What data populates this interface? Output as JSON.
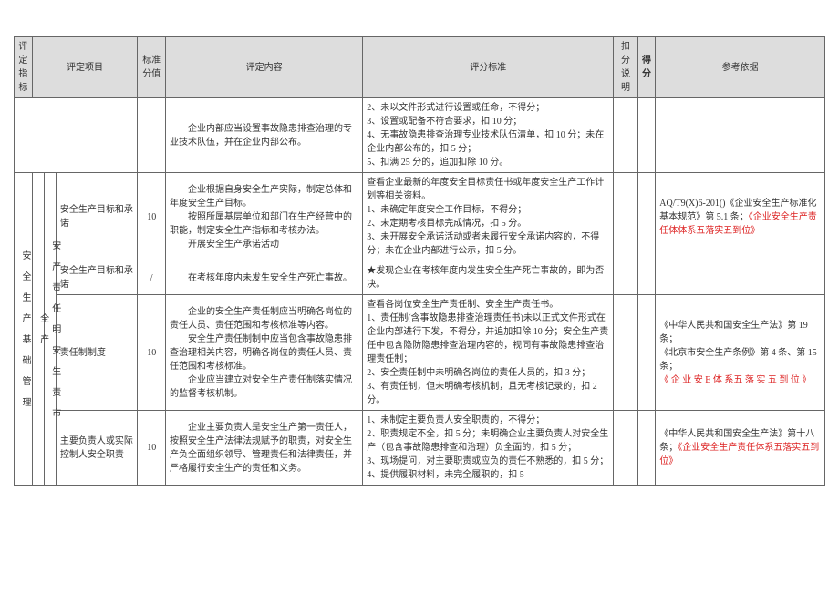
{
  "headers": {
    "c1": "评 定 指标",
    "c2": "评定项目",
    "c3": "标准 分值",
    "c4": "评定内容",
    "c5": "评分标准",
    "c6": "扣分 说明",
    "c7": "得分",
    "c8": "参考依据"
  },
  "vert": {
    "l1": "安 全 生 产 基 础 管 理",
    "l2a": "全 产",
    "l2b": "安 产 责 任 明 安 生 责 市"
  },
  "rows": {
    "r0": {
      "content": "企业内部应当设置事故隐患排查治理的专业技术队伍，并在企业内部公布。",
      "standard": "2、未以文件形式进行设置或任命，不得分；\n3、设置或配备不符合要求，扣 10 分；\n4、无事故隐患排查治理专业技术队伍清单，扣 10 分；未在企业内部公布的，扣 5 分；\n5、扣满 25 分的，追加扣除 10 分。"
    },
    "r1": {
      "project": "安全生产目标和承诺",
      "score": "10",
      "content": "企业根据自身安全生产实际，制定总体和年度安全生产目标。\n　　按照所属基层单位和部门在生产经营中的职能，制定安全生产指标和考核办法。\n　　开展安全生产承诺活动",
      "standard": "查看企业最新的年度安全目标责任书或年度安全生产工作计划等相关资料。\n1、未确定年度安全工作目标，不得分；\n2、未定期考核目标完成情况，扣 5 分。\n3、未开展安全承诺活动或者未履行安全承诺内容的，不得分；未在企业内部进行公示，扣 5 分。",
      "ref_a": "AQ/T9(X)6-201()《企业安全生产标准化基本规范》第 5.1 条；",
      "ref_b": "《企业安全生产责任体体系五落实五到位》"
    },
    "r2": {
      "project": "安全生产目标和承诺",
      "score": "/",
      "content": "在考核年度内未发生安全生产死亡事故。",
      "standard": "★发现企业在考核年度内发生安全生产死亡事故的，即为否决。"
    },
    "r3": {
      "project": "责任制制度",
      "score": "10",
      "content": "企业的安全生产责任制应当明确各岗位的责任人员、责任范围和考核标准等内容。\n　　安全生产责任制制中应当包含事故隐患排查治理相关内容，明确各岗位的责任人员、责任范围和考核标准。\n　　企业应当建立对安全生产责任制落实情况的监督考核机制。",
      "standard": "查看各岗位安全生产责任制、安全生产责任书。\n1、责任制(含事故隐患排查治理责任书)未以正式文件形式在企业内部进行下发，不得分，并追加扣除 10 分；安全生产责任中包含隐防隐患排查治理内容的，视同有事故隐患排查治理责任制；\n2、安全责任制中未明确各岗位的责任人员的，扣 3 分；\n3、有责任制，但未明确考核机制，且无考核记录的，扣 2 分。",
      "ref_a": "《中华人民共和国安全生产法》第 19 条；\n《北京市安全生产条例》第 4 条、第 15 条；",
      "ref_b": "《 企 业 安     E 体 系五 落 实 五 到 位 》"
    },
    "r4": {
      "project": "主要负责人或实际控制人安全职责",
      "score": "10",
      "content": "企业主要负责人是安全生产第一责任人，按照安全生产法律法规赋予的职责，对安全生产负全面组织领导、管理责任和法律责任，并严格履行安全生产的责任和义务。",
      "standard": "1、未制定主要负责人安全职责的，不得分；\n2、职责规定不全，扣 5 分；未明确企业主要负责人对安全生产（包含事故隐患排查和治理）负全面的，扣 5 分；\n3、现场提问，对主要职责或应负的责任不熟悉的，扣 5 分；  4、提供履职材料，未完全履职的，扣 5",
      "ref_a": "《中华人民共和国安全生产法》第十八条；",
      "ref_b": "《企业安全生产责任体系五落实五到位》"
    }
  }
}
